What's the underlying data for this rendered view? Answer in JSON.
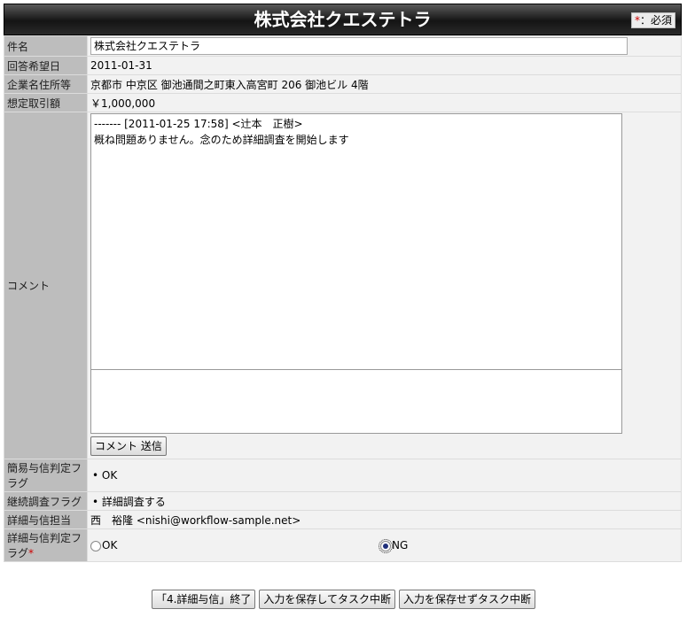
{
  "header": {
    "title": "株式会社クエステトラ",
    "required_star": "*",
    "required_text": "：必須"
  },
  "fields": {
    "subject": {
      "label": "件名",
      "value": "株式会社クエステトラ"
    },
    "reply_date": {
      "label": "回答希望日",
      "value": "2011-01-31"
    },
    "address": {
      "label": "企業名住所等",
      "value": "京都市 中京区 御池通間之町東入高宮町 206 御池ビル 4階"
    },
    "amount": {
      "label": "想定取引額",
      "value": "￥1,000,000"
    },
    "comment": {
      "label": "コメント",
      "history": "------- [2011-01-25 17:58] <辻本　正樹>\n概ね問題ありません。念のため詳細調査を開始します",
      "new_value": "",
      "send_button": "コメント 送信"
    },
    "simple_flag": {
      "label": "簡易与信判定フラグ",
      "value": "OK"
    },
    "continue_flag": {
      "label": "継続調査フラグ",
      "value": "詳細調査する"
    },
    "assignee": {
      "label": "詳細与信担当",
      "value": "西　裕隆 <nishi@workflow-sample.net>"
    },
    "detail_flag": {
      "label": "詳細与信判定フラグ",
      "required_star": "*",
      "options": [
        {
          "label": "OK",
          "selected": false
        },
        {
          "label": "NG",
          "selected": true
        }
      ]
    }
  },
  "footer": {
    "finish_button": "「4.詳細与信」終了",
    "save_suspend_button": "入力を保存してタスク中断",
    "nosave_suspend_button": "入力を保存せずタスク中断"
  }
}
